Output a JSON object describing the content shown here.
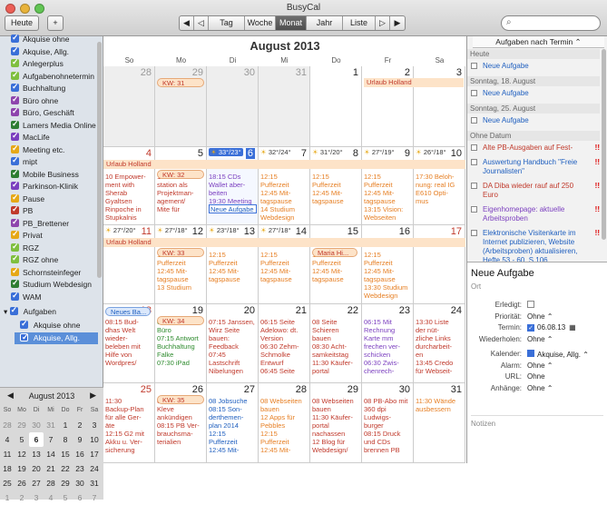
{
  "window": {
    "title": "BusyCal"
  },
  "toolbar": {
    "today": "Heute",
    "add": "+",
    "views": [
      "Tag",
      "Woche",
      "Monat",
      "Jahr",
      "Liste"
    ],
    "active_view": "Monat",
    "nav_prev2": "◀",
    "nav_prev": "◁",
    "nav_next": "▷",
    "nav_next2": "▶",
    "search_placeholder": ""
  },
  "sidebar": {
    "calendars": [
      {
        "label": "Akquise ohne",
        "color": "#3a6fd8"
      },
      {
        "label": "Akquise, Allg.",
        "color": "#3a6fd8"
      },
      {
        "label": "Anlegerplus",
        "color": "#7fbf3f"
      },
      {
        "label": "Aufgabenohnetermin",
        "color": "#7fbf3f"
      },
      {
        "label": "Buchhaltung",
        "color": "#3a6fd8"
      },
      {
        "label": "Büro ohne",
        "color": "#8e44ad"
      },
      {
        "label": "Büro, Geschäft",
        "color": "#8e44ad"
      },
      {
        "label": "Lamers Media Online",
        "color": "#2e7d32"
      },
      {
        "label": "MacLife",
        "color": "#7b3fbf"
      },
      {
        "label": "Meeting etc.",
        "color": "#e6a817"
      },
      {
        "label": "mipt",
        "color": "#3a6fd8"
      },
      {
        "label": "Mobile Business",
        "color": "#2e7d32"
      },
      {
        "label": "Parkinson-Klinik",
        "color": "#7b3fbf"
      },
      {
        "label": "Pause",
        "color": "#e6a817"
      },
      {
        "label": "PB",
        "color": "#c0392b"
      },
      {
        "label": "PB_Brettener",
        "color": "#8e44ad"
      },
      {
        "label": "Privat",
        "color": "#e6a817"
      },
      {
        "label": "RGZ",
        "color": "#7fbf3f"
      },
      {
        "label": "RGZ ohne",
        "color": "#7fbf3f"
      },
      {
        "label": "Schornsteinfeger",
        "color": "#e6a817"
      },
      {
        "label": "Studium Webdesign",
        "color": "#2e7d32"
      },
      {
        "label": "WAM",
        "color": "#3a6fd8"
      }
    ],
    "group_label": "Aufgaben",
    "group_items": [
      {
        "label": "Akquise ohne",
        "color": "#3a6fd8",
        "selected": false
      },
      {
        "label": "Akquise, Allg.",
        "color": "#3a6fd8",
        "selected": true
      }
    ]
  },
  "mini_calendar": {
    "title": "August 2013",
    "prev": "◀",
    "next": "▶",
    "headers": [
      "So",
      "Mo",
      "Di",
      "Mi",
      "Do",
      "Fr",
      "Sa"
    ],
    "weeks": [
      [
        "28",
        "29",
        "30",
        "31",
        "1",
        "2",
        "3"
      ],
      [
        "4",
        "5",
        "6",
        "7",
        "8",
        "9",
        "10"
      ],
      [
        "11",
        "12",
        "13",
        "14",
        "15",
        "16",
        "17"
      ],
      [
        "18",
        "19",
        "20",
        "21",
        "22",
        "23",
        "24"
      ],
      [
        "25",
        "26",
        "27",
        "28",
        "29",
        "30",
        "31"
      ],
      [
        "1",
        "2",
        "3",
        "4",
        "5",
        "6",
        "7"
      ]
    ],
    "today": "6"
  },
  "month": {
    "title": "August 2013",
    "headers": [
      "So",
      "Mo",
      "Di",
      "Mi",
      "Do",
      "Fr",
      "Sa"
    ],
    "weeks": [
      {
        "days": [
          "28",
          "29",
          "30",
          "31",
          "1",
          "2",
          "3"
        ],
        "kw": "KW: 31",
        "bar": "Urlaub Holland",
        "weather": []
      },
      {
        "days": [
          "4",
          "5",
          "6",
          "7",
          "8",
          "9",
          "10"
        ],
        "kw": "KW: 32",
        "bar": "Urlaub Holland",
        "weather": [
          "33°/23°",
          "32°/24°",
          "31°/20°",
          "27°/19°",
          "26°/18°"
        ]
      },
      {
        "days": [
          "11",
          "12",
          "13",
          "14",
          "15",
          "16",
          "17"
        ],
        "kw": "KW: 33",
        "bar": "Urlaub Holland",
        "weather": [
          "27°/20°",
          "27°/18°",
          "23°/18°",
          "27°/18°"
        ]
      },
      {
        "days": [
          "18",
          "19",
          "20",
          "21",
          "22",
          "23",
          "24"
        ],
        "kw": "KW: 34",
        "bar": "",
        "weather": []
      },
      {
        "days": [
          "25",
          "26",
          "27",
          "28",
          "29",
          "30",
          "31"
        ],
        "kw": "KW: 35",
        "bar": "",
        "weather": []
      }
    ],
    "events": {
      "w2_so": "10 Empower-\nment with\nSherab\nGyaltsen\nRinpoche in\nStupkalnis",
      "w2_mo": "18:15 Central-\nstation als\nProjektman-\nagement/\nMite für",
      "w2_di": "18:15 CDs\nWallet aber-\nbeiten\n19:30 Meeting",
      "w2_di_task": "Neue Aufgabe",
      "w2_mi": "12:15\nPufferzeit\n12:45 Mit-\ntagspause\n14 Studium\nWebdesign",
      "w2_do": "12:15\nPufferzeit\n12:45 Mit-\ntagspause",
      "w2_fr": "12:15\nPufferzeit\n12:45 Mit-\ntagspause\n13:15 Vision:\nWebseiten",
      "w2_sa": "17:30 Beloh-\nnung: real IG\nE610 Opti-\nmus",
      "w3_mo": "12:15\nPufferzeit\n12:45 Mit-\ntagspause\n13 Studium",
      "w3_di": "12:15\nPufferzeit\n12:45 Mit-\ntagspause",
      "w3_mi": "12:15\nPufferzeit\n12:45 Mit-\ntagspause",
      "w3_do_pill": "Maria Hi...",
      "w3_do": "12:15\nPufferzeit\n12:45 Mit-\ntagspause",
      "w3_fr": "12:15\nPufferzeit\n12:45 Mit-\ntagspause\n13:30 Studium\nWebdesign",
      "w4_so_pill": "Neues Ba...",
      "w4_so": "08:15 Bud-\ndhas Welt\nwieder-\nbeleben mit\nHilfe von\nWordpres/",
      "w4_mo": "07 Obst fürs\nBüro\n07:15 Antwort\nBuchhaltung\nFalke\n07:30 iPad",
      "w4_di": "07:15 Janssen,\nWirz Seite\nbauen:\nFeedback\n07:45\nLastschrift\nNibelungen",
      "w4_mi": "06:15 Seite\nAdelowo: dt.\nVersion\n06:30 Zehm-\nSchmolke\nEntwurf\n06:45 Seite",
      "w4_do": "08 Seite\nSchieren\nbauen\n08:30 Acht-\nsamkeitstag\n11:30 Käufer-\nportal",
      "w4_fr": "06:15 Mit\nRechnung\nKarte mm\nfrechen ver-\nschicken\n06:30 Zwis-\nchenrech-",
      "w4_sa": "13:30 Liste\nder nüt-\nzliche Links\ndurcharbeit-\nen\n13:45 Credo\nfür Webseit-",
      "w5_so": "11:30\nBackup-Plan\nfür alle Ger-\näte\n12:15 G2 mit\nAkku u. Ver-\nsicherung",
      "w5_mo": "08 Besuch in\nKleve\nankündigen\n08:15 PB Ver-\nbrauchsma-\nterialien",
      "w5_di": "08 Jobsuche\n08:15 Son-\nderthemen-\nplan 2014\n12:15\nPufferzeit\n12:45 Mit-",
      "w5_mi": "08 Webseiten\nbauen\n12 Apps für\nPebbles\n12:15\nPufferzeit\n12:45 Mit-",
      "w5_do": "08 Webseiten\nbauen\n11:30 Käufer-\nportal\nnachassen\n12 Blog für\nWebdesign/",
      "w5_fr": "08 PB-Abo mit\n360 dpi\nLudwigs-\nburger\n08:15 Druck\nund CDs\nbrennen PB",
      "w5_sa": "11:30 Wände\nausbessern"
    }
  },
  "todo_panel": {
    "selector": "Aufgaben nach Termin ⌃",
    "sections": [
      {
        "title": "Heute",
        "items": [
          {
            "text": "Neue Aufgabe",
            "color": "#1f5fbf",
            "prio": ""
          }
        ]
      },
      {
        "title": "Sonntag, 18. August",
        "items": [
          {
            "text": "Neue Aufgabe",
            "color": "#1f5fbf",
            "prio": ""
          }
        ]
      },
      {
        "title": "Sonntag, 25. August",
        "items": [
          {
            "text": "Neue Aufgabe",
            "color": "#1f5fbf",
            "prio": ""
          }
        ]
      },
      {
        "title": "Ohne Datum",
        "items": [
          {
            "text": "Alte PB-Ausgaben auf Fest-",
            "color": "#c0392b",
            "prio": "!!"
          },
          {
            "text": "Auswertung Handbuch \"Freie Journalisten\"",
            "color": "#1f5fbf",
            "prio": "!!"
          },
          {
            "text": "DA Diba wieder rauf auf 250 Euro",
            "color": "#c0392b",
            "prio": "!!"
          },
          {
            "text": "Eigenhomepage: aktuelle Arbeitsproben",
            "color": "#7b3fbf",
            "prio": "!!"
          },
          {
            "text": "Elektronische Visitenkarte im Internet publizieren, Website (Arbeitsproben) aktualisieren, Hefte 53 - 60, S.106",
            "color": "#1f5fbf",
            "prio": "!!"
          }
        ]
      }
    ]
  },
  "task_detail": {
    "title": "Neue Aufgabe",
    "location_placeholder": "Ort",
    "rows": [
      {
        "label": "Erledigt:",
        "value": ""
      },
      {
        "label": "Priorität:",
        "value": "Ohne ⌃"
      },
      {
        "label": "Termin:",
        "value": "06.08.13"
      },
      {
        "label": "Wiederholen:",
        "value": "Ohne ⌃"
      },
      {
        "label": "Kalender:",
        "value": "Akquise, Allg. ⌃"
      },
      {
        "label": "Alarm:",
        "value": "Ohne ⌃"
      },
      {
        "label": "URL:",
        "value": "Ohne"
      },
      {
        "label": "Anhänge:",
        "value": "Ohne ⌃"
      }
    ],
    "notes_placeholder": "Notizen"
  },
  "colors": {
    "accent": "#3a6fd8",
    "holiday_bar": "#fde3c8",
    "event_red": "#c0392b",
    "event_blue": "#1f5fbf",
    "event_green": "#2e8b2e",
    "event_purple": "#7b3fbf",
    "event_orange": "#e67e22"
  }
}
